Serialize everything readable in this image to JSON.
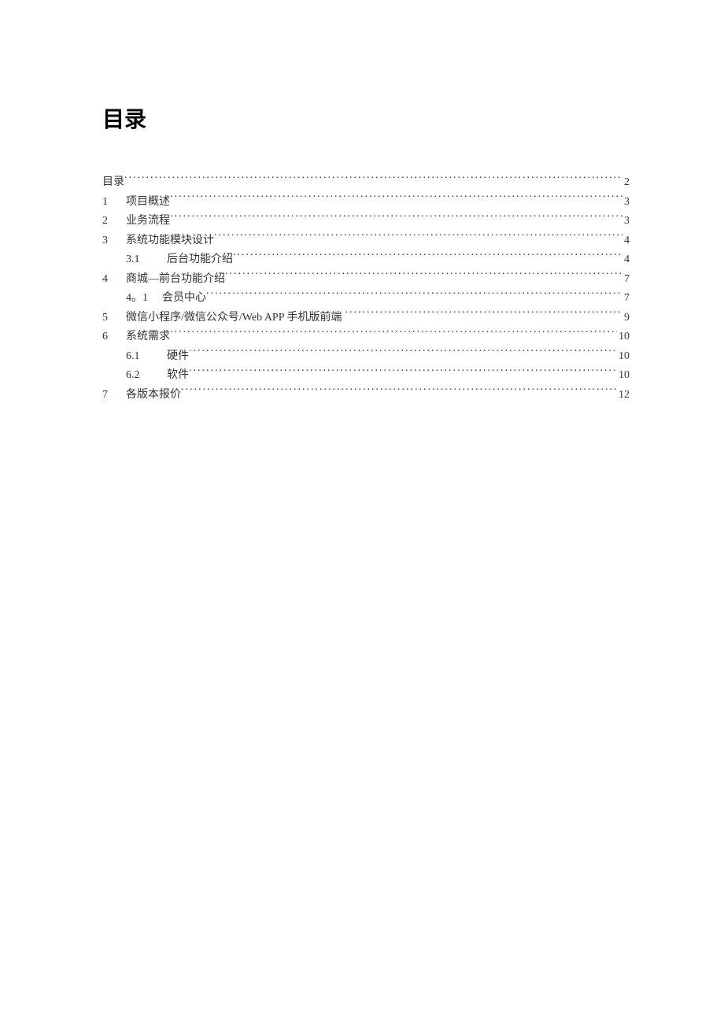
{
  "title": "目录",
  "toc": [
    {
      "num": "",
      "sub": "",
      "text": "目录",
      "page": "2",
      "indent": false,
      "subItem": false,
      "leadSpace": false
    },
    {
      "num": "1",
      "sub": "",
      "text": "项目概述",
      "page": "3",
      "indent": false,
      "subItem": false
    },
    {
      "num": "2",
      "sub": "",
      "text": "业务流程",
      "page": "3",
      "indent": false,
      "subItem": false
    },
    {
      "num": "3",
      "sub": "",
      "text": "系统功能模块设计",
      "page": "4",
      "indent": false,
      "subItem": false
    },
    {
      "num": "",
      "sub": "3.1",
      "text": "后台功能介绍",
      "page": "4",
      "indent": true,
      "subItem": true
    },
    {
      "num": "4",
      "sub": "",
      "text": "商城—前台功能介绍",
      "page": "7",
      "indent": false,
      "subItem": false
    },
    {
      "num": "",
      "sub": "4。1",
      "text": "会员中心",
      "page": "7",
      "indent": true,
      "subItem": true
    },
    {
      "num": "5",
      "sub": "",
      "text": "微信小程序/微信公众号/Web APP 手机版前端",
      "page": "9",
      "indent": false,
      "subItem": false
    },
    {
      "num": "6",
      "sub": "",
      "text": "系统需求",
      "page": "10",
      "indent": false,
      "subItem": false
    },
    {
      "num": "",
      "sub": "6.1",
      "text": "硬件",
      "page": "10",
      "indent": true,
      "subItem": true
    },
    {
      "num": "",
      "sub": "6.2",
      "text": "软件",
      "page": "10",
      "indent": true,
      "subItem": true
    },
    {
      "num": "7",
      "sub": "",
      "text": "各版本报价",
      "page": "12",
      "indent": false,
      "subItem": false
    }
  ]
}
